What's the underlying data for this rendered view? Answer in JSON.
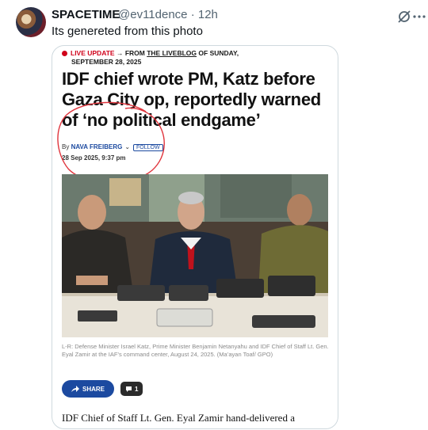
{
  "tweet": {
    "author_name": "SPACETIME",
    "handle": "@ev11dence",
    "separator": "·",
    "time": "12h",
    "text": "Its genereted from this photo",
    "icons": [
      "grok-icon",
      "more-icon"
    ]
  },
  "article": {
    "live_label": "LIVE UPDATE",
    "kicker_mid": "→ FROM",
    "kicker_link": "THE LIVEBLOG",
    "kicker_tail": "OF SUNDAY,",
    "kicker_date": "SEPTEMBER 28, 2025",
    "headline": "IDF chief wrote PM, Katz before Gaza City op, reportedly warned of ‘no political endgame’",
    "byline_prefix": "By",
    "author": "NAVA FREIBERG",
    "follow_label": "FOLLOW",
    "date": "28 Sep 2025, 9:37 pm",
    "caption": "L-R: Defense Minister Israel Katz, Prime Minister Benjamin Netanyahu and IDF Chief of Staff Lt. Gen. Eyal Zamir at the IAF’s command center, August 24, 2025. (Ma’ayan Toaf/ GPO)",
    "share_label": "SHARE",
    "comment_count": "1",
    "body_start": "IDF Chief of Staff Lt. Gen. Eyal Zamir hand-delivered a"
  },
  "colors": {
    "live_red": "#d0021b",
    "accent_blue": "#1c4aa0",
    "annotation_red": "#e0343c"
  }
}
